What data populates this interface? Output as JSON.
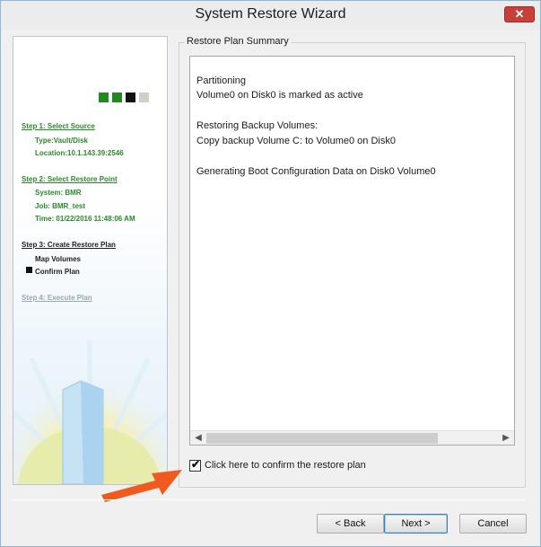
{
  "window": {
    "title": "System Restore Wizard",
    "close_glyph": "✕"
  },
  "sidebar": {
    "progress_colors": [
      "#1f8a1f",
      "#1f8a1f",
      "#111111",
      "#d0d0c8"
    ],
    "steps": [
      {
        "label": "Step 1: Select Source",
        "details": [
          "Type:Vault/Disk",
          "Location:10.1.143.39:2546"
        ]
      },
      {
        "label": "Step 2: Select Restore Point",
        "details": [
          "System: BMR",
          "Job: BMR_test",
          "Time: 01/22/2016 11:48:06 AM"
        ]
      },
      {
        "label": "Step 3: Create Restore Plan",
        "details": [
          "Map Volumes",
          "Confirm Plan"
        ]
      },
      {
        "label": "Step 4: Execute Plan",
        "details": []
      }
    ]
  },
  "summary": {
    "group_title": "Restore Plan Summary",
    "lines": [
      "Partitioning",
      "Volume0 on Disk0 is marked as active",
      "Restoring Backup Volumes:",
      "Copy backup Volume C: to Volume0 on Disk0",
      "Generating Boot Configuration Data on Disk0 Volume0"
    ]
  },
  "confirm": {
    "label": "Click here to confirm the restore plan",
    "checked": true
  },
  "buttons": {
    "back": "< Back",
    "next": "Next >",
    "cancel": "Cancel"
  },
  "colors": {
    "accent_green": "#2a8a2a",
    "annotation_arrow": "#f05a1e"
  }
}
